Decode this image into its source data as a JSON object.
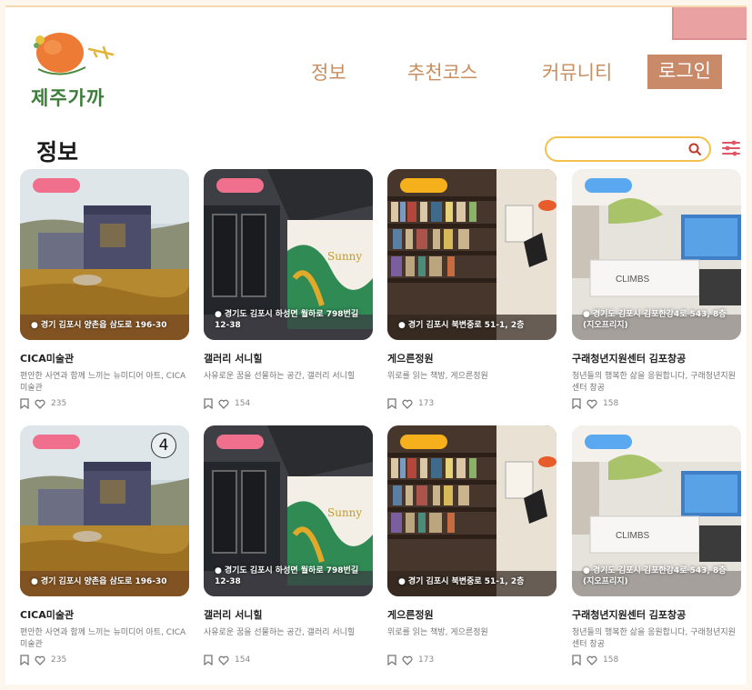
{
  "brand": {
    "logo_text": "제주가까"
  },
  "nav": {
    "items": [
      "정보",
      "추천코스",
      "커뮤니티"
    ],
    "login": "로그인"
  },
  "page": {
    "title": "정보"
  },
  "search": {
    "value": "",
    "placeholder": ""
  },
  "colors": {
    "nav_text": "#c98e5f",
    "login_bg": "#c98a69",
    "search_border": "#f2c14e",
    "tag_pink": "#f06f8c",
    "tag_yellow": "#f5b01c",
    "tag_blue": "#5aa8f0"
  },
  "cards": [
    {
      "tag_color": "#f06f8c",
      "location": "경기 김포시 양촌읍 삼도로 196-30",
      "title": "CICA미술관",
      "desc": "편안한 사연과 함께 느끼는 뉴미디어 아트, CICA미술관",
      "likes": "235",
      "scene": "museum"
    },
    {
      "tag_color": "#f06f8c",
      "location": "경기도 김포시 하성면 월하로 798번길 12-38",
      "title": "갤러리 서니힐",
      "desc": "사유로운 꿈을 선물하는 공간, 갤러리 서니힐",
      "likes": "154",
      "scene": "gallery"
    },
    {
      "tag_color": "#f5b01c",
      "location": "경기 김포시 북변중로 51-1, 2층",
      "title": "게으른정원",
      "desc": "위로를 읽는 책방, 게으른정원",
      "likes": "173",
      "scene": "books"
    },
    {
      "tag_color": "#5aa8f0",
      "location": "경기도 김포시 김포한강4로 543, 8층 (지오프리지)",
      "title": "구래청년지원센터 김포창공",
      "desc": "청년들의 행복한 삶을 응원합니다, 구래청년지원센터 창공",
      "likes": "158",
      "scene": "office"
    },
    {
      "tag_color": "#f06f8c",
      "location": "경기 김포시 양촌읍 삼도로 196-30",
      "title": "CICA미술관",
      "desc": "편안한 사연과 함께 느끼는 뉴미디어 아트, CICA미술관",
      "likes": "235",
      "scene": "museum",
      "badge": "4"
    },
    {
      "tag_color": "#f06f8c",
      "location": "경기도 김포시 하성면 월하로 798번길 12-38",
      "title": "갤러리 서니힐",
      "desc": "사유로운 꿈을 선물하는 공간, 갤러리 서니힐",
      "likes": "154",
      "scene": "gallery"
    },
    {
      "tag_color": "#f5b01c",
      "location": "경기 김포시 북변중로 51-1, 2층",
      "title": "게으른정원",
      "desc": "위로를 읽는 책방, 게으른정원",
      "likes": "173",
      "scene": "books"
    },
    {
      "tag_color": "#5aa8f0",
      "location": "경기도 김포시 김포한강4로 543, 8층 (지오프리지)",
      "title": "구래청년지원센터 김포창공",
      "desc": "청년들의 행복한 삶을 응원합니다, 구래청년지원센터 창공",
      "likes": "158",
      "scene": "office"
    }
  ]
}
